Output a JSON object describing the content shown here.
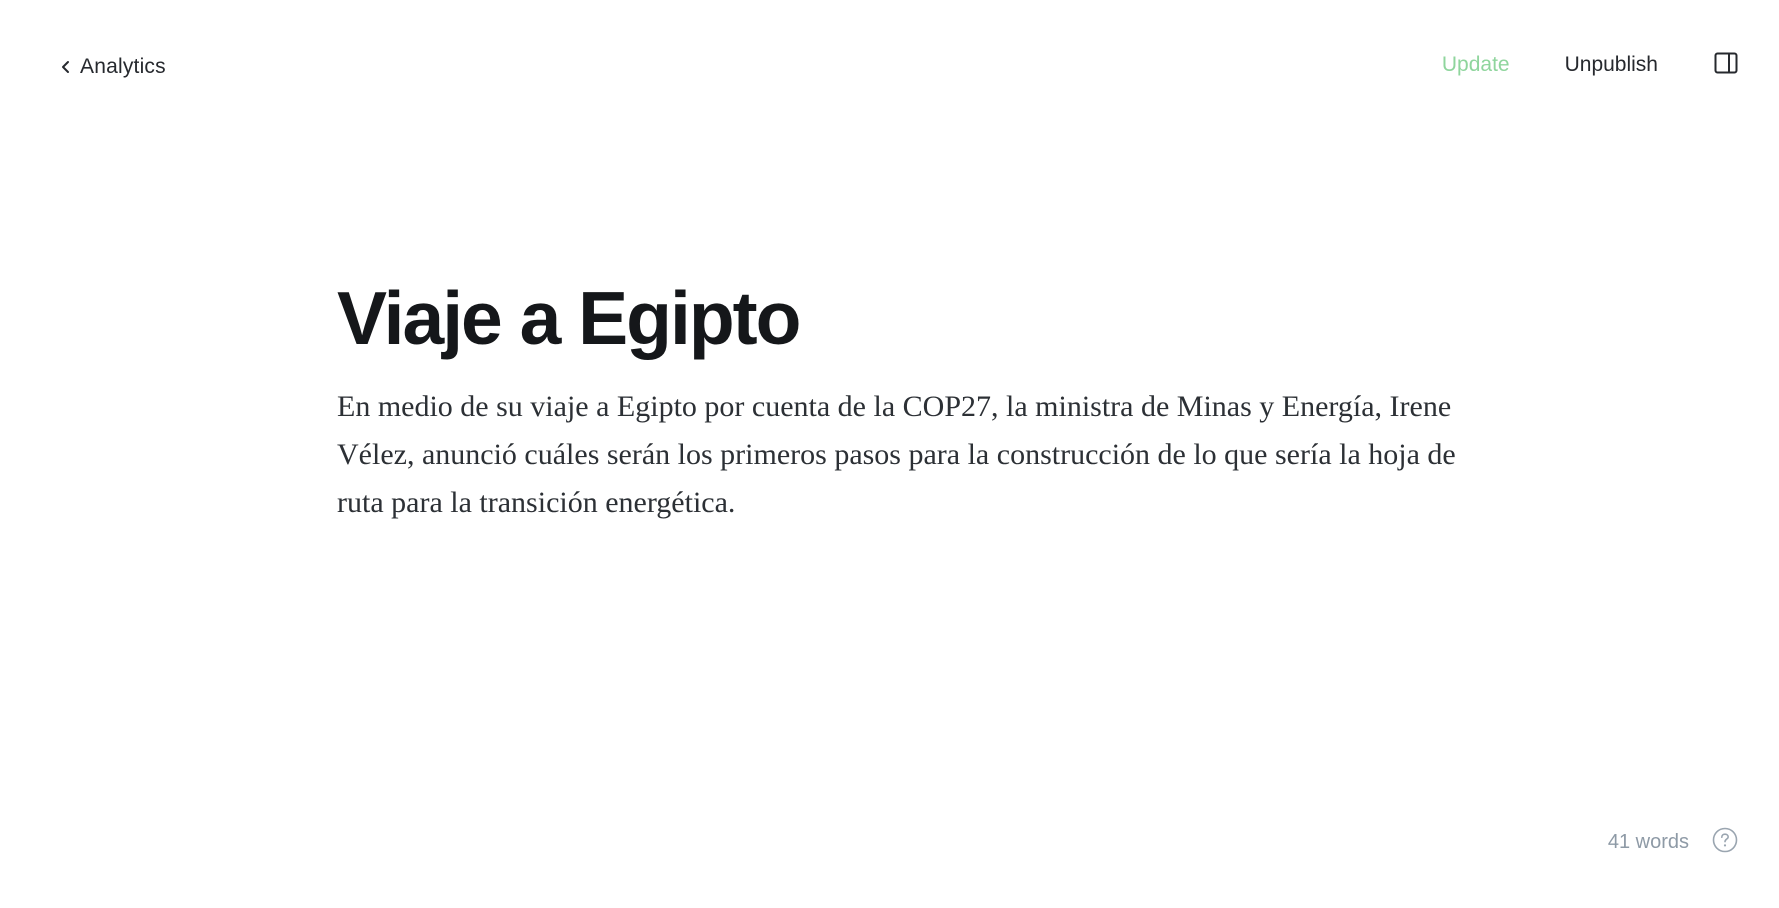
{
  "header": {
    "back_label": "Analytics",
    "update_label": "Update",
    "unpublish_label": "Unpublish",
    "icons": {
      "back": "chevron-left-icon",
      "sidebar": "sidebar-panel-icon"
    }
  },
  "post": {
    "title": "Viaje a Egipto",
    "body": "En medio de su viaje a Egipto por cuenta de la COP27, la ministra de Minas y Energía, Irene Vélez, anunció cuáles serán los primeros pasos para la construcción de lo que sería la hoja de ruta para la transición energética."
  },
  "footer": {
    "word_count": "41 words",
    "help_icon": "question-circle-icon"
  },
  "colors": {
    "update_accent": "#8fd59d",
    "text_primary": "#15171a",
    "text_muted": "#8e9aa6"
  }
}
